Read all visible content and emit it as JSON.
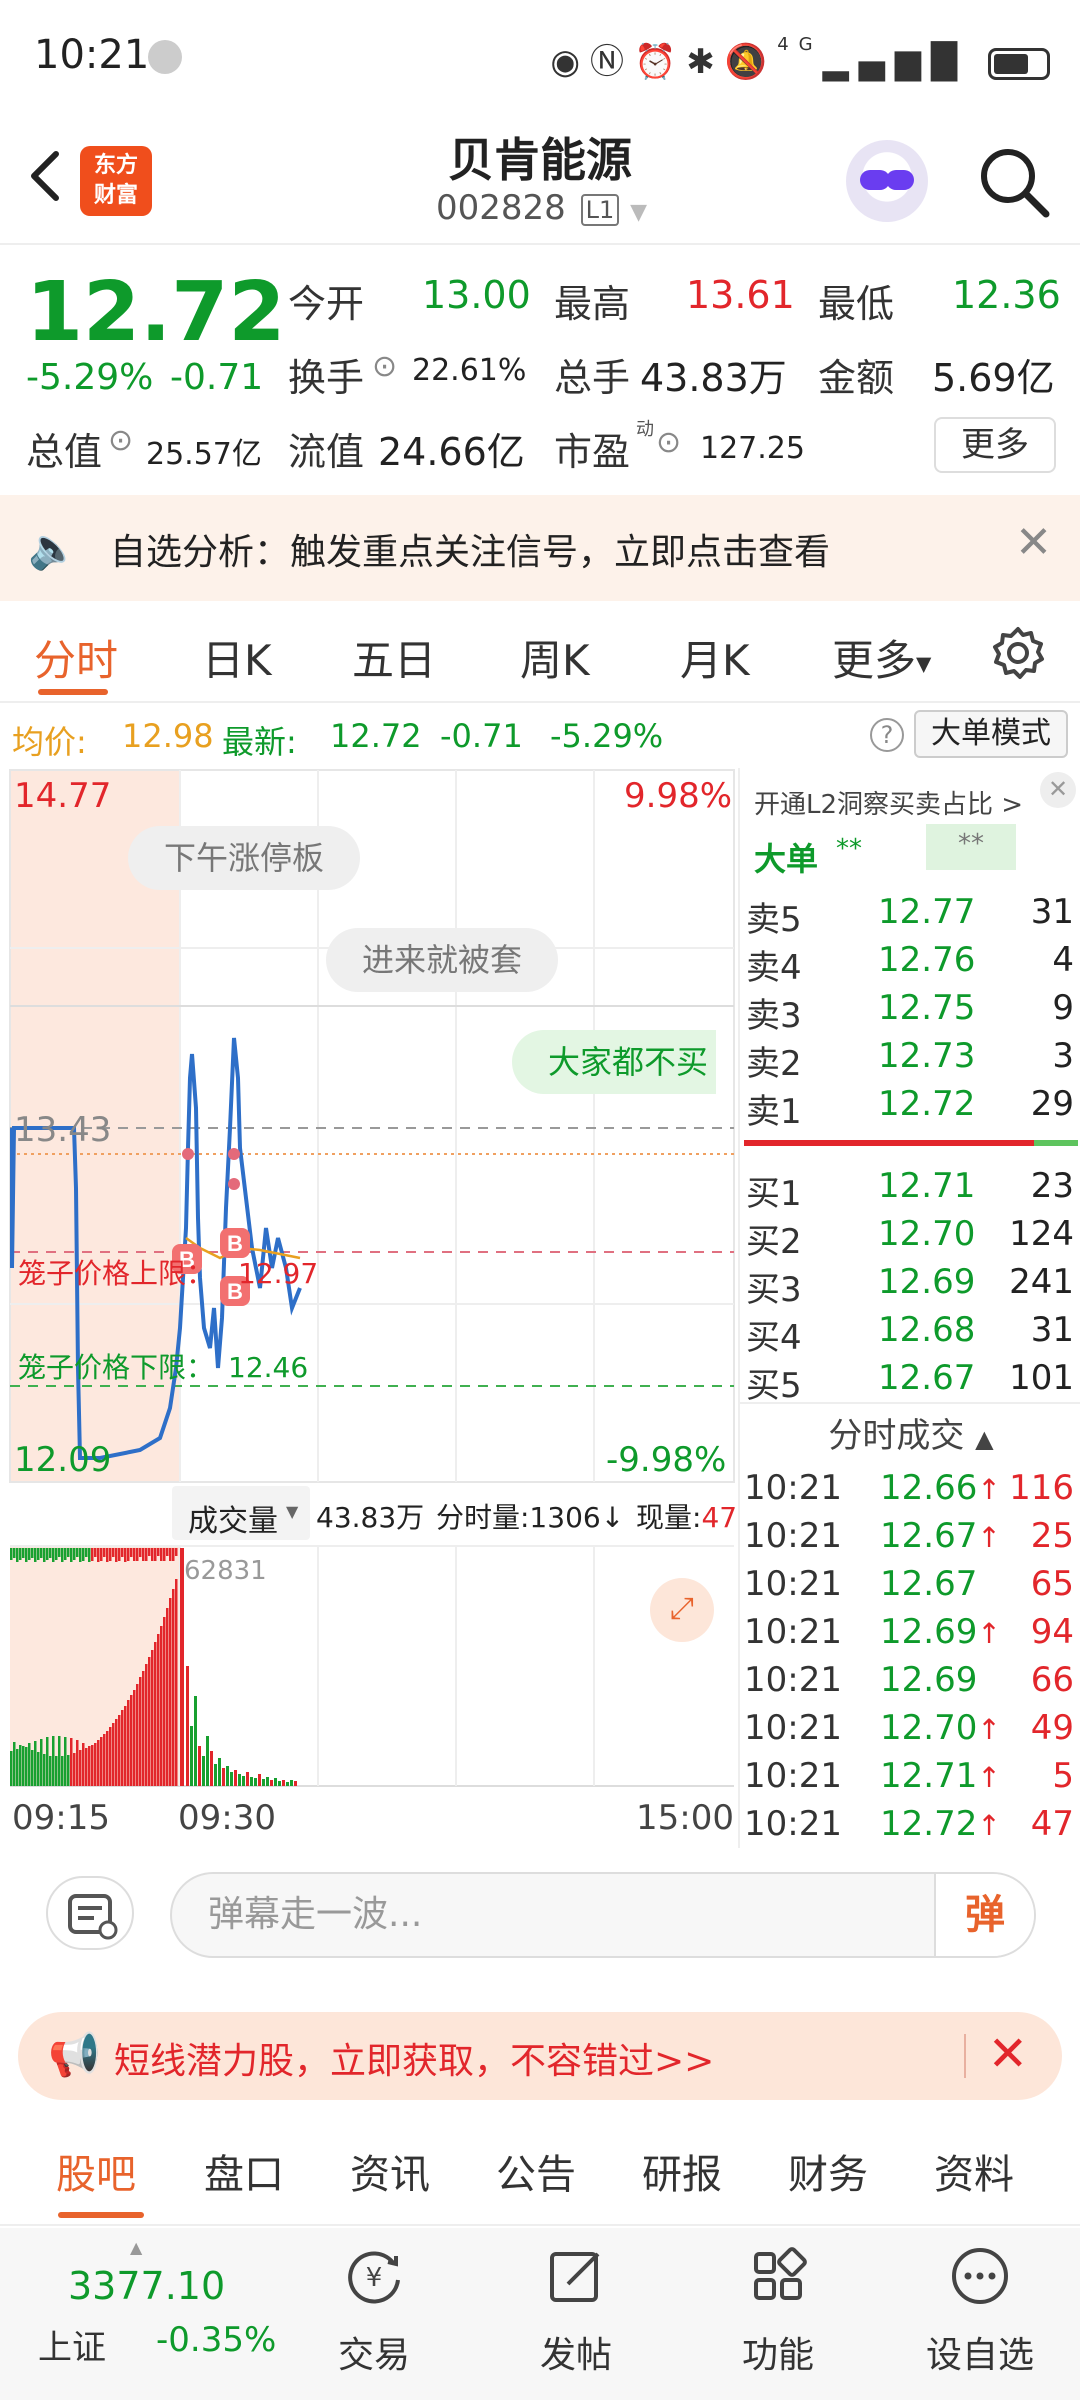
{
  "status": {
    "time": "10:21",
    "network": "4G"
  },
  "header": {
    "stock_name": "贝肯能源",
    "stock_code": "002828",
    "level_badge": "L1",
    "logo_text": "东方财富"
  },
  "quote": {
    "last_price": "12.72",
    "change_pct": "-5.29%",
    "change_val": "-0.71",
    "open_label": "今开",
    "open": "13.00",
    "high_label": "最高",
    "high": "13.61",
    "low_label": "最低",
    "low": "12.36",
    "turnover_label": "换手",
    "turnover": "22.61%",
    "volume_label": "总手",
    "volume": "43.83万",
    "amount_label": "金额",
    "amount": "5.69亿",
    "mktcap_label": "总值",
    "mktcap": "25.57亿",
    "float_label": "流值",
    "float": "24.66亿",
    "pe_label": "市盈",
    "pe_sup": "动",
    "pe": "127.25",
    "more_label": "更多"
  },
  "alert": {
    "text": "自选分析：触发重点关注信号，立即点击查看"
  },
  "chart_tabs": [
    "分时",
    "日K",
    "五日",
    "周K",
    "月K",
    "更多"
  ],
  "info_line": {
    "avg_label": "均价:",
    "avg": "12.98",
    "latest_label": "最新:",
    "latest": "12.72",
    "latest_chg": "-0.71",
    "latest_pct": "-5.29%",
    "mode_label": "大单模式"
  },
  "chart": {
    "top_price": "14.77",
    "top_pct": "9.98%",
    "bottom_price": "12.09",
    "bottom_pct": "-9.98%",
    "ref_price": "13.43",
    "upper_limit_label": "笼子价格上限：",
    "upper_limit": "12.97",
    "lower_limit_label": "笼子价格下限：",
    "lower_limit": "12.46",
    "bullets": [
      "下午涨停板",
      "进来就被套",
      "大家都不买"
    ],
    "vol_selector": "成交量",
    "vol_total": "43.83万",
    "vol_tick_label": "分时量:1306↓",
    "vol_now_label": "现量:",
    "vol_now": "47",
    "vol_max": "62831",
    "time_labels": [
      "09:15",
      "09:30",
      "15:00"
    ],
    "marker_letter": "B"
  },
  "book": {
    "header": "开通L2洞察买卖占比 >",
    "big_label": "大单",
    "big_val1": "**",
    "big_val2": "**",
    "asks": [
      {
        "label": "卖5",
        "price": "12.77",
        "vol": "31"
      },
      {
        "label": "卖4",
        "price": "12.76",
        "vol": "4"
      },
      {
        "label": "卖3",
        "price": "12.75",
        "vol": "9"
      },
      {
        "label": "卖2",
        "price": "12.73",
        "vol": "3"
      },
      {
        "label": "卖1",
        "price": "12.72",
        "vol": "29"
      }
    ],
    "bids": [
      {
        "label": "买1",
        "price": "12.71",
        "vol": "23"
      },
      {
        "label": "买2",
        "price": "12.70",
        "vol": "124"
      },
      {
        "label": "买3",
        "price": "12.69",
        "vol": "241"
      },
      {
        "label": "买4",
        "price": "12.68",
        "vol": "31"
      },
      {
        "label": "买5",
        "price": "12.67",
        "vol": "101"
      }
    ],
    "trades_header": "分时成交",
    "trades": [
      {
        "time": "10:21",
        "price": "12.66",
        "arrow": "↑",
        "vol": "116"
      },
      {
        "time": "10:21",
        "price": "12.67",
        "arrow": "↑",
        "vol": "25"
      },
      {
        "time": "10:21",
        "price": "12.67",
        "arrow": "",
        "vol": "65"
      },
      {
        "time": "10:21",
        "price": "12.69",
        "arrow": "↑",
        "vol": "94"
      },
      {
        "time": "10:21",
        "price": "12.69",
        "arrow": "",
        "vol": "66"
      },
      {
        "time": "10:21",
        "price": "12.70",
        "arrow": "↑",
        "vol": "49"
      },
      {
        "time": "10:21",
        "price": "12.71",
        "arrow": "↑",
        "vol": "5"
      },
      {
        "time": "10:21",
        "price": "12.72",
        "arrow": "↑",
        "vol": "47"
      }
    ]
  },
  "comment": {
    "placeholder": "弹幕走一波...",
    "send_label": "弹"
  },
  "promo": {
    "text": "短线潜力股，立即获取，不容错过>>"
  },
  "bottom_tabs": [
    "股吧",
    "盘口",
    "资讯",
    "公告",
    "研报",
    "财务",
    "资料"
  ],
  "nav": {
    "index_value": "3377.10",
    "index_name": "上证",
    "index_chg": "-0.35%",
    "items": [
      "交易",
      "发帖",
      "功能",
      "设自选"
    ]
  },
  "colors": {
    "up": "#e2262b",
    "down": "#0e9a2b",
    "accent": "#e8632c"
  }
}
